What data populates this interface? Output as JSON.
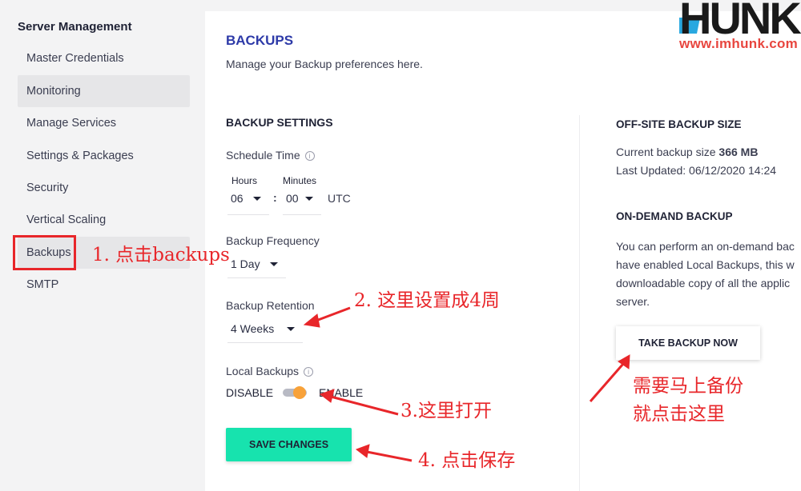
{
  "sidebar": {
    "title": "Server Management",
    "items": [
      {
        "label": "Master Credentials"
      },
      {
        "label": "Monitoring"
      },
      {
        "label": "Manage Services"
      },
      {
        "label": "Settings & Packages"
      },
      {
        "label": "Security"
      },
      {
        "label": "Vertical Scaling"
      },
      {
        "label": "Backups"
      },
      {
        "label": "SMTP"
      }
    ]
  },
  "main": {
    "title": "BACKUPS",
    "subtitle": "Manage your Backup preferences here.",
    "settings": {
      "title": "BACKUP SETTINGS",
      "schedule_label": "Schedule Time",
      "hours_label": "Hours",
      "minutes_label": "Minutes",
      "hours_value": "06",
      "minutes_value": "00",
      "separator": ":",
      "timezone": "UTC",
      "frequency_label": "Backup Frequency",
      "frequency_value": "1 Day",
      "retention_label": "Backup Retention",
      "retention_value": "4 Weeks",
      "local_label": "Local Backups",
      "disable": "DISABLE",
      "enable": "ENABLE",
      "local_enabled": true,
      "save": "SAVE CHANGES"
    },
    "offsite": {
      "title": "OFF-SITE BACKUP SIZE",
      "current_prefix": "Current backup size ",
      "current_value": "366 MB",
      "updated": "Last Updated: 06/12/2020 14:24"
    },
    "ondemand": {
      "title": "ON-DEMAND BACKUP",
      "lines": [
        "You can perform an on-demand bac",
        "have enabled Local Backups, this w",
        "downloadable copy of all the applic",
        "server."
      ],
      "button": "TAKE BACKUP NOW"
    }
  },
  "annotations": {
    "a1": "1. 点击backups",
    "a2": "2. 这里设置成4周",
    "a3": "3.这里打开",
    "a4": "4. 点击保存",
    "a5_1": "需要马上备份",
    "a5_2": "就点击这里",
    "color": "#e8262a"
  },
  "watermark": {
    "brand": "HUNK",
    "url": "www.imhunk.com"
  }
}
